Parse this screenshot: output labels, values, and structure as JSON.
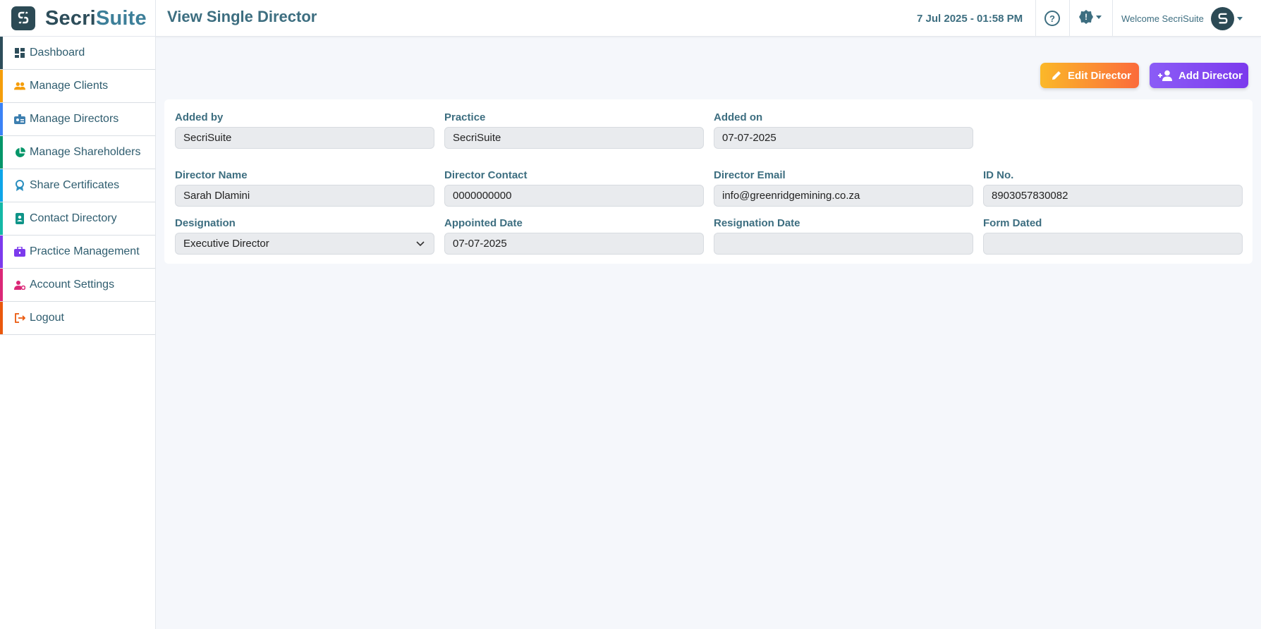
{
  "app": {
    "brand_prefix": "Secri",
    "brand_suffix": "Suite",
    "page_title": "View Single Director",
    "datetime": "7 Jul 2025 - 01:58 PM",
    "help_icon_glyph": "?",
    "welcome": "Welcome SecriSuite"
  },
  "sidebar": {
    "items": [
      {
        "label": "Dashboard",
        "icon": "dashboard-icon",
        "color": "#2d4d5a"
      },
      {
        "label": "Manage Clients",
        "icon": "users-icon",
        "color": "#f59e0b"
      },
      {
        "label": "Manage Directors",
        "icon": "id-badge-icon",
        "color": "#3b82f6"
      },
      {
        "label": "Manage Shareholders",
        "icon": "pie-chart-icon",
        "color": "#059669"
      },
      {
        "label": "Share Certificates",
        "icon": "award-icon",
        "color": "#0ea5e9"
      },
      {
        "label": "Contact Directory",
        "icon": "contact-book-icon",
        "color": "#14b8a6"
      },
      {
        "label": "Practice Management",
        "icon": "briefcase-icon",
        "color": "#7c3aed"
      },
      {
        "label": "Account Settings",
        "icon": "user-cog-icon",
        "color": "#db2777"
      },
      {
        "label": "Logout",
        "icon": "logout-icon",
        "color": "#ea580c"
      }
    ]
  },
  "actions": {
    "edit_label": "Edit Director",
    "add_label": "Add Director"
  },
  "form": {
    "added_by": {
      "label": "Added by",
      "value": "SecriSuite"
    },
    "practice": {
      "label": "Practice",
      "value": "SecriSuite"
    },
    "added_on": {
      "label": "Added on",
      "value": "07-07-2025"
    },
    "director_name": {
      "label": "Director Name",
      "value": "Sarah Dlamini"
    },
    "director_contact": {
      "label": "Director Contact",
      "value": "0000000000"
    },
    "director_email": {
      "label": "Director Email",
      "value": "info@greenridgemining.co.za"
    },
    "id_no": {
      "label": "ID No.",
      "value": "8903057830082"
    },
    "designation": {
      "label": "Designation",
      "value": "Executive Director"
    },
    "appointed_date": {
      "label": "Appointed Date",
      "value": "07-07-2025"
    },
    "resignation_date": {
      "label": "Resignation Date",
      "value": ""
    },
    "form_dated": {
      "label": "Form Dated",
      "value": ""
    }
  }
}
